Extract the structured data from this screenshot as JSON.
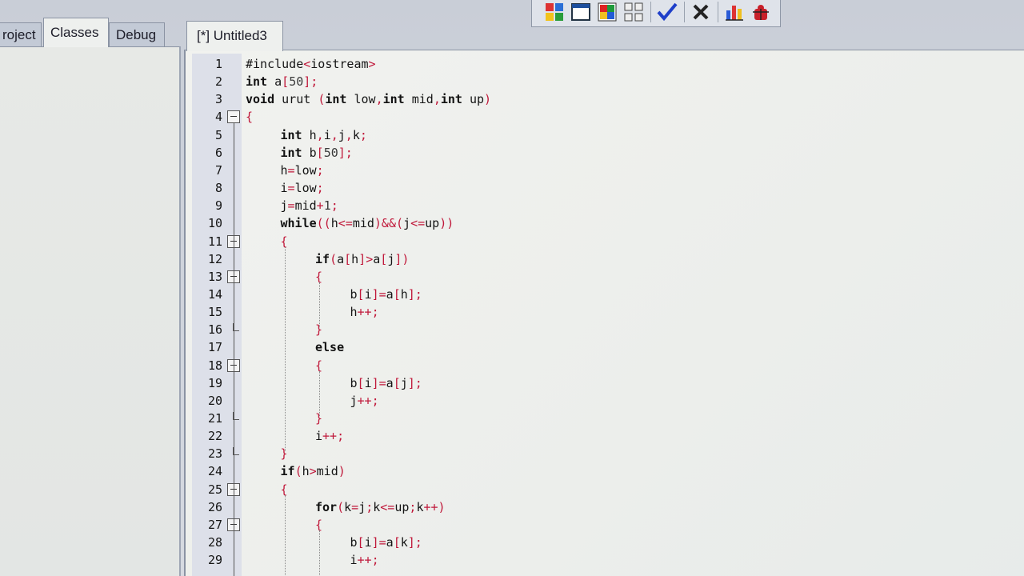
{
  "left_tabs": [
    {
      "label": "roject",
      "active": false
    },
    {
      "label": "Classes",
      "active": true
    },
    {
      "label": "Debug",
      "active": false
    }
  ],
  "editor_tab": {
    "label": "[*] Untitled3"
  },
  "toolbar": {
    "icons": [
      "grid-color-icon",
      "window-icon",
      "color-grid-icon",
      "grid-icon",
      "check-icon",
      "close-icon",
      "chart-icon",
      "debug-icon"
    ]
  },
  "colors": {
    "keyword": "#111111",
    "symbol": "#c0183a",
    "gutter": "#dde0e9"
  },
  "editor": {
    "lines": [
      {
        "n": "1",
        "indent": 0,
        "fold": "",
        "code": "#include<iostream>"
      },
      {
        "n": "2",
        "indent": 0,
        "fold": "",
        "code": "int a[50];"
      },
      {
        "n": "3",
        "indent": 0,
        "fold": "",
        "code": "void urut (int low,int mid,int up)"
      },
      {
        "n": "4",
        "indent": 0,
        "fold": "box",
        "code": "{"
      },
      {
        "n": "5",
        "indent": 1,
        "fold": "",
        "code": "int h,i,j,k;"
      },
      {
        "n": "6",
        "indent": 1,
        "fold": "",
        "code": "int b[50];"
      },
      {
        "n": "7",
        "indent": 1,
        "fold": "",
        "code": "h=low;"
      },
      {
        "n": "8",
        "indent": 1,
        "fold": "",
        "code": "i=low;"
      },
      {
        "n": "9",
        "indent": 1,
        "fold": "",
        "code": "j=mid+1;"
      },
      {
        "n": "10",
        "indent": 1,
        "fold": "",
        "code": "while((h<=mid)&&(j<=up))"
      },
      {
        "n": "11",
        "indent": 1,
        "fold": "box",
        "code": "{"
      },
      {
        "n": "12",
        "indent": 2,
        "fold": "",
        "code": "if(a[h]>a[j])"
      },
      {
        "n": "13",
        "indent": 2,
        "fold": "box",
        "code": "{"
      },
      {
        "n": "14",
        "indent": 3,
        "fold": "",
        "code": "b[i]=a[h];"
      },
      {
        "n": "15",
        "indent": 3,
        "fold": "",
        "code": "h++;"
      },
      {
        "n": "16",
        "indent": 2,
        "fold": "end",
        "code": "}"
      },
      {
        "n": "17",
        "indent": 2,
        "fold": "",
        "code": "else"
      },
      {
        "n": "18",
        "indent": 2,
        "fold": "box",
        "code": "{"
      },
      {
        "n": "19",
        "indent": 3,
        "fold": "",
        "code": "b[i]=a[j];"
      },
      {
        "n": "20",
        "indent": 3,
        "fold": "",
        "code": "j++;"
      },
      {
        "n": "21",
        "indent": 2,
        "fold": "end",
        "code": "}"
      },
      {
        "n": "22",
        "indent": 2,
        "fold": "",
        "code": "i++;"
      },
      {
        "n": "23",
        "indent": 1,
        "fold": "end",
        "code": "}"
      },
      {
        "n": "24",
        "indent": 1,
        "fold": "",
        "code": "if(h>mid)"
      },
      {
        "n": "25",
        "indent": 1,
        "fold": "box",
        "code": "{"
      },
      {
        "n": "26",
        "indent": 2,
        "fold": "",
        "code": "for(k=j;k<=up;k++)"
      },
      {
        "n": "27",
        "indent": 2,
        "fold": "box",
        "code": "{"
      },
      {
        "n": "28",
        "indent": 3,
        "fold": "",
        "code": "b[i]=a[k];"
      },
      {
        "n": "29",
        "indent": 3,
        "fold": "",
        "code": "i++;"
      }
    ]
  }
}
